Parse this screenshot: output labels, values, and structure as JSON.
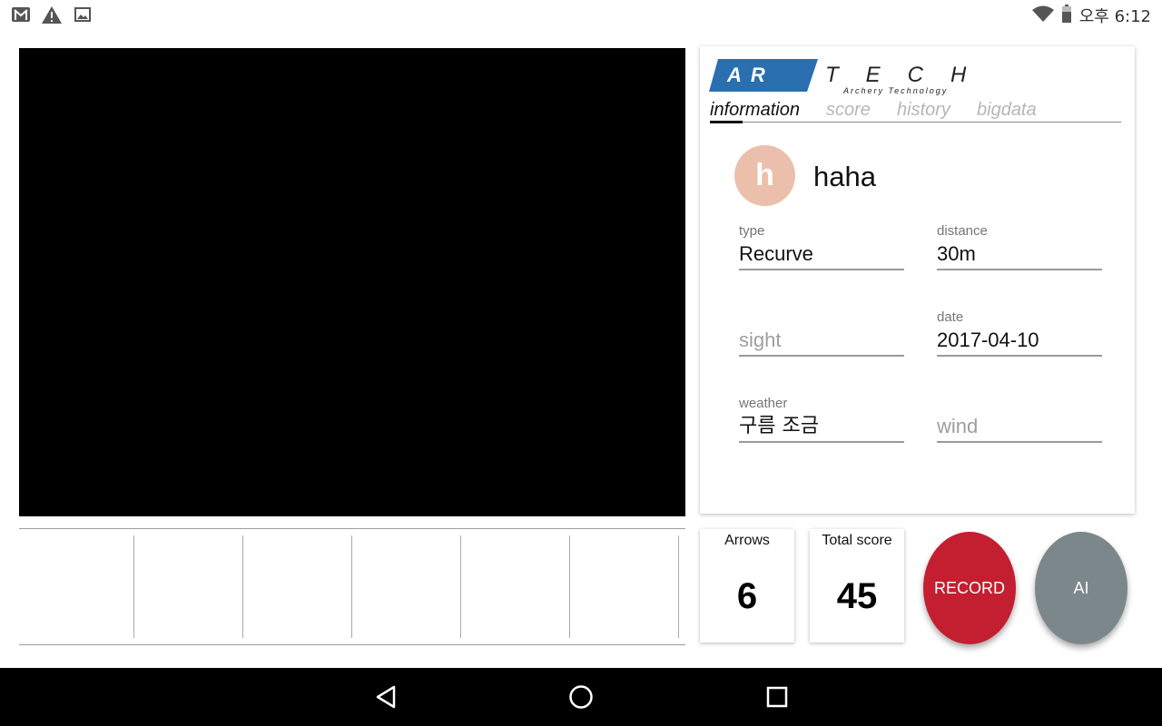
{
  "statusbar": {
    "icons_left": [
      "gmail-icon",
      "warning-icon",
      "image-icon"
    ],
    "icons_right": [
      "wifi-icon",
      "battery-icon"
    ],
    "time": "오후 6:12"
  },
  "logo": {
    "brand_left": "AR",
    "brand_right": "TECH",
    "tagline": "Archery Technology",
    "color": "#2a6fb0"
  },
  "tabs": [
    {
      "label": "information",
      "active": true
    },
    {
      "label": "score",
      "active": false
    },
    {
      "label": "history",
      "active": false
    },
    {
      "label": "bigdata",
      "active": false
    }
  ],
  "profile": {
    "initial": "h",
    "name": "haha",
    "avatar_color": "#ecbfac"
  },
  "fields": {
    "type": {
      "label": "type",
      "value": "Recurve"
    },
    "distance": {
      "label": "distance",
      "value": "30m"
    },
    "sight": {
      "label": "",
      "placeholder": "sight",
      "value": ""
    },
    "date": {
      "label": "date",
      "value": "2017-04-10"
    },
    "weather": {
      "label": "weather",
      "value": "구름 조금"
    },
    "wind": {
      "label": "",
      "placeholder": "wind",
      "value": ""
    }
  },
  "stats": {
    "arrows_label": "Arrows",
    "arrows_value": "6",
    "total_label": "Total score",
    "total_value": "45"
  },
  "buttons": {
    "record": "RECORD",
    "ai": "AI",
    "record_color": "#c41e31",
    "ai_color": "#7c878c"
  },
  "arrow_slots": [
    "",
    "",
    "",
    "",
    "",
    ""
  ],
  "navbar": {
    "icons": [
      "back-icon",
      "home-icon",
      "recents-icon"
    ]
  }
}
